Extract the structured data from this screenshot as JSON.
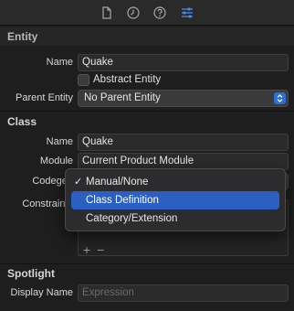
{
  "toolbar": {
    "tabs": [
      {
        "icon": "file-icon"
      },
      {
        "icon": "clock-icon"
      },
      {
        "icon": "help-icon"
      },
      {
        "icon": "sliders-icon",
        "active": true
      }
    ]
  },
  "entity": {
    "header": "Entity",
    "name_label": "Name",
    "name_value": "Quake",
    "abstract_label": "Abstract Entity",
    "abstract_checked": false,
    "parent_label": "Parent Entity",
    "parent_value": "No Parent Entity"
  },
  "class": {
    "header": "Class",
    "name_label": "Name",
    "name_value": "Quake",
    "module_label": "Module",
    "module_value": "Current Product Module",
    "codegen_label": "Codegen",
    "constraints_label": "Constraints"
  },
  "codegen_menu": {
    "items": [
      {
        "label": "Manual/None",
        "checked": true,
        "highlighted": false
      },
      {
        "label": "Class Definition",
        "checked": false,
        "highlighted": true
      },
      {
        "label": "Category/Extension",
        "checked": false,
        "highlighted": false
      }
    ],
    "checkmark": "✓"
  },
  "constraints": {
    "add": "+",
    "remove": "−"
  },
  "spotlight": {
    "header": "Spotlight",
    "display_name_label": "Display Name",
    "display_name_placeholder": "Expression"
  },
  "colors": {
    "accent": "#2b5fc2",
    "active_icon": "#4a8fe7"
  }
}
